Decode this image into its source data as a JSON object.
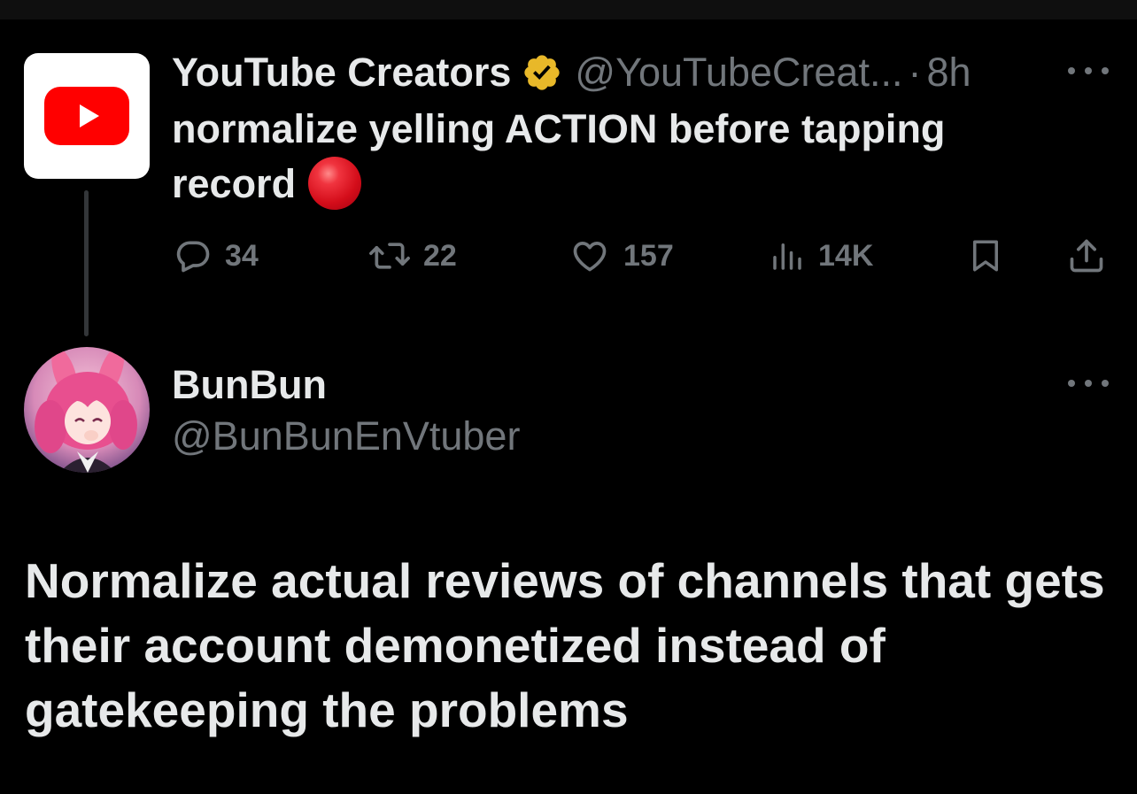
{
  "parent_tweet": {
    "display_name": "YouTube Creators",
    "handle": "@YouTubeCreat...",
    "separator": "·",
    "time": "8h",
    "text": "normalize yelling ACTION before tapping record",
    "emoji": "red-circle",
    "stats": {
      "replies": "34",
      "retweets": "22",
      "likes": "157",
      "views": "14K"
    }
  },
  "reply_tweet": {
    "display_name": "BunBun",
    "handle": "@BunBunEnVtuber",
    "text": "Normalize actual reviews of channels that gets their account demonetized instead of gatekeeping the problems"
  },
  "icons": {
    "verified": "verified-badge-icon",
    "reply": "reply-icon",
    "retweet": "retweet-icon",
    "like": "heart-icon",
    "views": "views-chart-icon",
    "bookmark": "bookmark-icon",
    "share": "share-icon",
    "more": "more-icon"
  },
  "colors": {
    "background": "#000000",
    "primary_text": "#e7e9ea",
    "secondary_text": "#71767b",
    "verified_gold": "#e8b829",
    "youtube_red": "#ff0000"
  }
}
